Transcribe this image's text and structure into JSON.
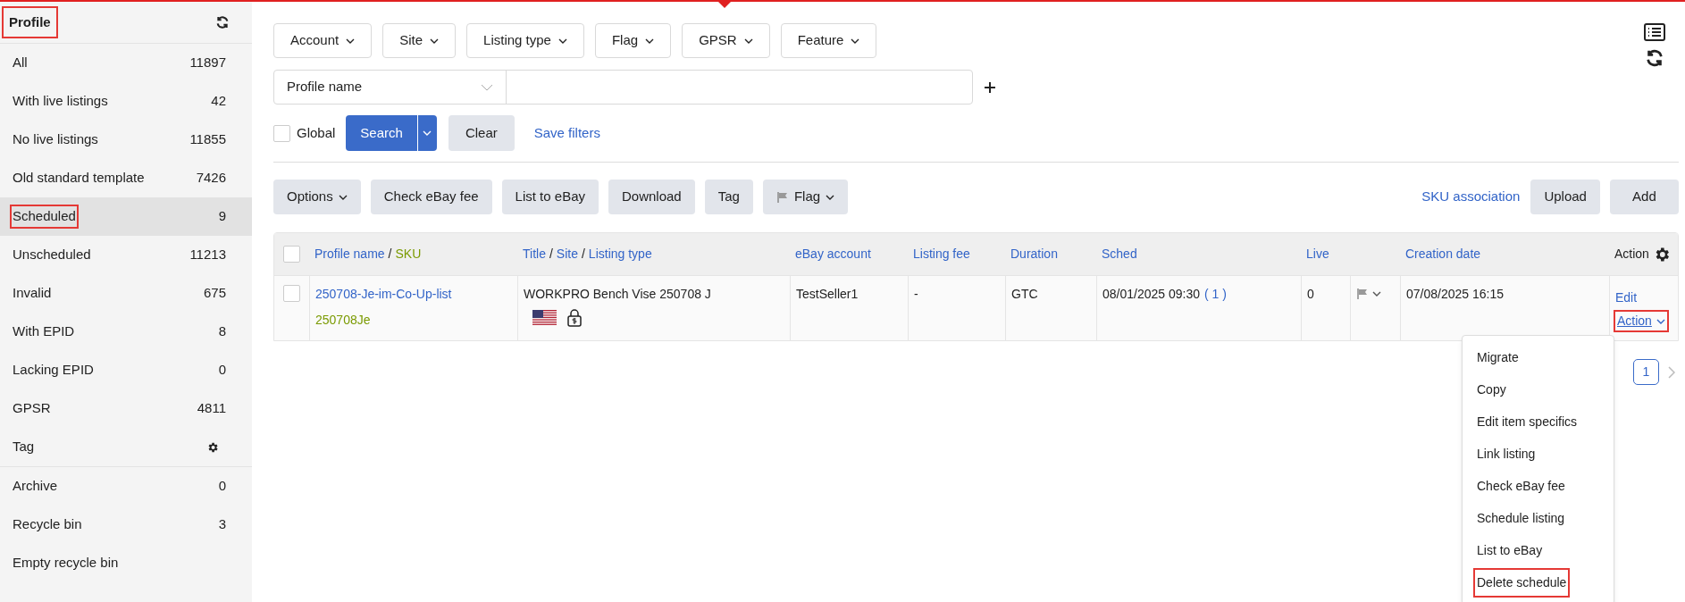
{
  "sidebar": {
    "title": "Profile",
    "title_highlighted": true,
    "items": [
      {
        "kind": "count",
        "label": "All",
        "count": "11897",
        "selected": false,
        "highlighted": false
      },
      {
        "kind": "count",
        "label": "With live listings",
        "count": "42",
        "selected": false,
        "highlighted": false
      },
      {
        "kind": "count",
        "label": "No live listings",
        "count": "11855",
        "selected": false,
        "highlighted": false
      },
      {
        "kind": "count",
        "label": "Old standard template",
        "count": "7426",
        "selected": false,
        "highlighted": false
      },
      {
        "kind": "count",
        "label": "Scheduled",
        "count": "9",
        "selected": true,
        "highlighted": true
      },
      {
        "kind": "count",
        "label": "Unscheduled",
        "count": "11213",
        "selected": false,
        "highlighted": false
      },
      {
        "kind": "count",
        "label": "Invalid",
        "count": "675",
        "selected": false,
        "highlighted": false
      },
      {
        "kind": "count",
        "label": "With EPID",
        "count": "8",
        "selected": false,
        "highlighted": false
      },
      {
        "kind": "count",
        "label": "Lacking EPID",
        "count": "0",
        "selected": false,
        "highlighted": false
      },
      {
        "kind": "count",
        "label": "GPSR",
        "count": "4811",
        "selected": false,
        "highlighted": false
      },
      {
        "kind": "gear",
        "label": "Tag",
        "selected": false,
        "highlighted": false
      }
    ],
    "bottom_items": [
      {
        "kind": "count",
        "label": "Archive",
        "count": "0",
        "selected": false,
        "highlighted": false
      },
      {
        "kind": "count",
        "label": "Recycle bin",
        "count": "3",
        "selected": false,
        "highlighted": false
      },
      {
        "kind": "plain",
        "label": "Empty recycle bin",
        "selected": false,
        "highlighted": false
      }
    ]
  },
  "filters": [
    "Account",
    "Site",
    "Listing type",
    "Flag",
    "GPSR",
    "Feature"
  ],
  "search": {
    "field_select": "Profile name",
    "global_label": "Global",
    "global_checked": false,
    "search_button": "Search",
    "clear_button": "Clear",
    "save_link": "Save filters"
  },
  "toolbar": {
    "buttons": [
      {
        "label": "Options",
        "kind": "dropdown"
      },
      {
        "label": "Check eBay fee",
        "kind": "plain"
      },
      {
        "label": "List to eBay",
        "kind": "plain"
      },
      {
        "label": "Download",
        "kind": "plain"
      },
      {
        "label": "Tag",
        "kind": "plain"
      },
      {
        "label": "Flag",
        "kind": "flag"
      }
    ],
    "sku_link": "SKU association",
    "right_buttons": [
      "Upload",
      "Add"
    ]
  },
  "table": {
    "all_checked": false,
    "columns": [
      {
        "parts": [
          {
            "text": "Profile name",
            "kind": "link"
          },
          {
            "text": "/",
            "kind": "plain"
          },
          {
            "text": "SKU",
            "kind": "sku"
          }
        ]
      },
      {
        "parts": [
          {
            "text": "Title",
            "kind": "link"
          },
          {
            "text": "/",
            "kind": "plain"
          },
          {
            "text": "Site",
            "kind": "link"
          },
          {
            "text": "/",
            "kind": "plain"
          },
          {
            "text": "Listing type",
            "kind": "link"
          }
        ]
      },
      {
        "parts": [
          {
            "text": "eBay account",
            "kind": "link"
          }
        ]
      },
      {
        "parts": [
          {
            "text": "Listing fee",
            "kind": "link"
          }
        ]
      },
      {
        "parts": [
          {
            "text": "Duration",
            "kind": "link"
          }
        ]
      },
      {
        "parts": [
          {
            "text": "Sched",
            "kind": "link"
          }
        ]
      },
      {
        "parts": [
          {
            "text": "Live",
            "kind": "link"
          }
        ]
      },
      {},
      {
        "parts": [
          {
            "text": "Creation date",
            "kind": "link"
          }
        ]
      },
      {
        "parts": [
          {
            "text": "Action",
            "kind": "plain"
          }
        ]
      }
    ],
    "rows": [
      {
        "checked": false,
        "profile_name": "250708-Je-im-Co-Up-list",
        "sku": "250708Je",
        "title": "WORKPRO Bench Vise 250708 J",
        "ebay_account": "TestSeller1",
        "listing_fee": "-",
        "duration": "GTC",
        "sched": "08/01/2025 09:30",
        "sched_count": "( 1 )",
        "live": "0",
        "creation_date": "07/08/2025 16:15",
        "edit": "Edit",
        "action": "Action",
        "action_highlighted": true
      }
    ]
  },
  "action_menu": [
    {
      "label": "Migrate",
      "highlighted": false
    },
    {
      "label": "Copy",
      "highlighted": false
    },
    {
      "label": "Edit item specifics",
      "highlighted": false
    },
    {
      "label": "Link listing",
      "highlighted": false
    },
    {
      "label": "Check eBay fee",
      "highlighted": false
    },
    {
      "label": "Schedule listing",
      "highlighted": false
    },
    {
      "label": "List to eBay",
      "highlighted": false
    },
    {
      "label": "Delete schedule",
      "highlighted": true
    }
  ],
  "pagination": [
    {
      "label": "1",
      "selected": true
    }
  ]
}
